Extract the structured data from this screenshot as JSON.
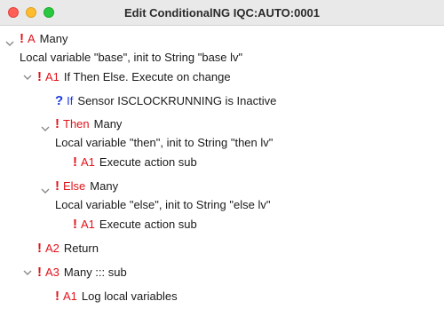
{
  "window": {
    "title": "Edit ConditionalNG IQC:AUTO:0001"
  },
  "tree": {
    "n1": {
      "code": "A",
      "text": "Many"
    },
    "n2": {
      "text": "Local variable \"base\", init to String \"base lv\""
    },
    "n3": {
      "code": "A1",
      "text": "If Then Else. Execute on change"
    },
    "n4": {
      "code": "If",
      "text": "Sensor ISCLOCKRUNNING is Inactive"
    },
    "n5": {
      "code": "Then",
      "text": "Many"
    },
    "n6": {
      "text": "Local variable \"then\", init to String \"then lv\""
    },
    "n7": {
      "code": "A1",
      "text": "Execute action sub"
    },
    "n8": {
      "code": "Else",
      "text": "Many"
    },
    "n9": {
      "text": "Local variable \"else\", init to String \"else lv\""
    },
    "n10": {
      "code": "A1",
      "text": "Execute action sub"
    },
    "n11": {
      "code": "A2",
      "text": "Return"
    },
    "n12": {
      "code": "A3",
      "text": "Many ::: sub"
    },
    "n13": {
      "code": "A1",
      "text": "Log local variables"
    }
  },
  "glyphs": {
    "exclamation": "!",
    "question": "?"
  },
  "colors": {
    "error_red": "#e0131b",
    "question_blue": "#1d3bdc"
  }
}
